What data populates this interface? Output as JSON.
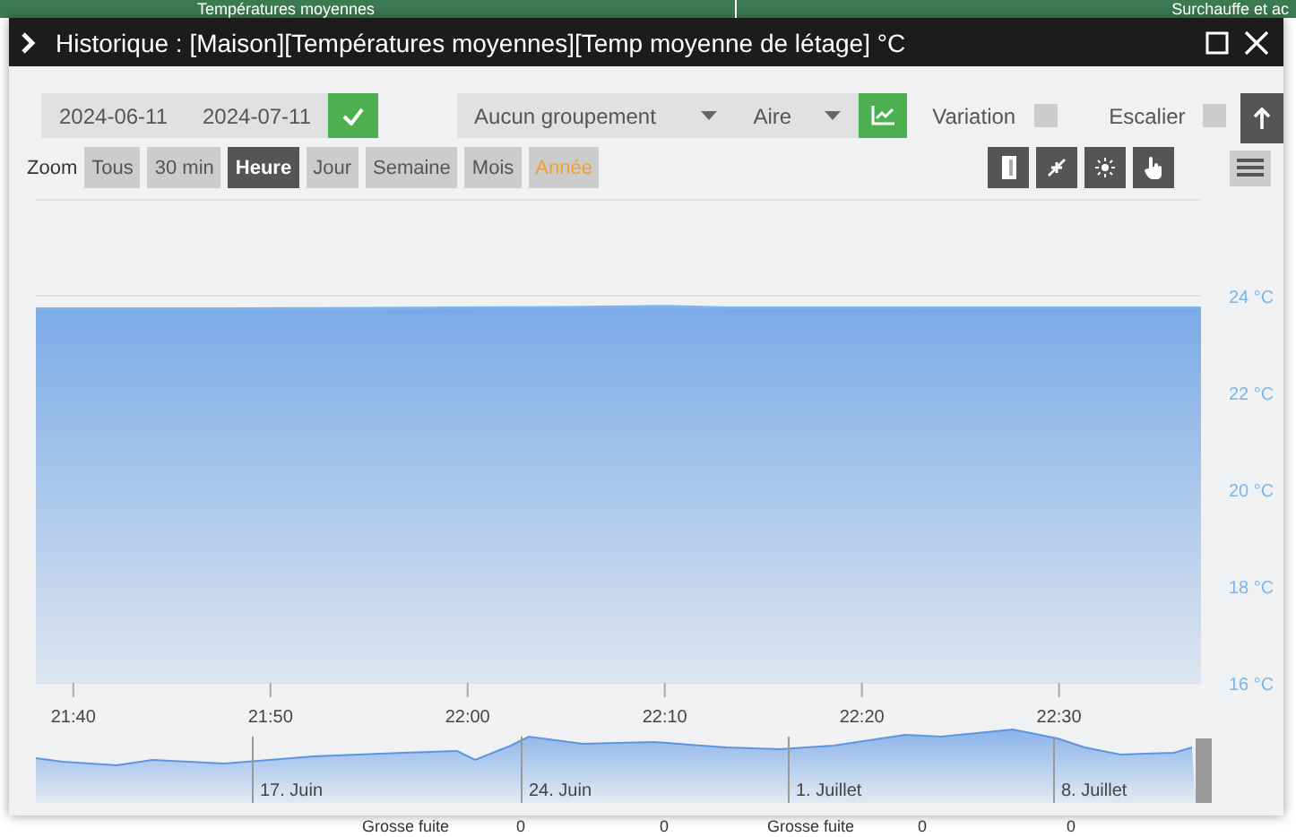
{
  "background": {
    "top_bar": [
      "Températures moyennes",
      "Surchauffe et ac"
    ],
    "bottom_row": [
      "Grosse fuite",
      "0",
      "0",
      "Grosse fuite",
      "0",
      "0"
    ]
  },
  "window": {
    "title": "Historique : [Maison][Températures moyennes][Temp moyenne de létage] °C"
  },
  "toolbar": {
    "start_date": "2024-06-11",
    "end_date": "2024-07-11",
    "grouping": "Aucun groupement",
    "chart_type": "Aire",
    "options": [
      {
        "label": "Variation",
        "checked": false
      },
      {
        "label": "Escalier",
        "checked": false
      }
    ]
  },
  "zoom": {
    "label": "Zoom",
    "buttons": [
      {
        "label": "Tous",
        "selected": false,
        "hovered": false
      },
      {
        "label": "30 min",
        "selected": false,
        "hovered": false
      },
      {
        "label": "Heure",
        "selected": true,
        "hovered": false
      },
      {
        "label": "Jour",
        "selected": false,
        "hovered": false
      },
      {
        "label": "Semaine",
        "selected": false,
        "hovered": false
      },
      {
        "label": "Mois",
        "selected": false,
        "hovered": false
      },
      {
        "label": "Année",
        "selected": false,
        "hovered": true
      }
    ]
  },
  "chart": {
    "chart_data": {
      "type": "area",
      "x": [
        1298.1,
        1305,
        1315,
        1325,
        1330,
        1333.2,
        1357.2
      ],
      "series": [
        {
          "color": "#7cb5ec",
          "values": [
            23.73,
            23.73,
            23.74,
            23.76,
            23.78,
            23.75,
            23.75
          ]
        }
      ],
      "ylim": [
        16,
        26
      ],
      "xlim": [
        1298.1,
        1357.2
      ],
      "yticks": [
        {
          "value": 16,
          "label": "16 °C"
        },
        {
          "value": 18,
          "label": "18 °C"
        },
        {
          "value": 20,
          "label": "20 °C"
        },
        {
          "value": 22,
          "label": "22 °C"
        },
        {
          "value": 24,
          "label": "24 °C"
        }
      ],
      "xticks": [
        {
          "value": 1300,
          "label": "21:40"
        },
        {
          "value": 1310,
          "label": "21:50"
        },
        {
          "value": 1320,
          "label": "22:00"
        },
        {
          "value": 1330,
          "label": "22:10"
        },
        {
          "value": 1340,
          "label": "22:20"
        },
        {
          "value": 1350,
          "label": "22:30"
        }
      ]
    },
    "navigator_labels": [
      "17. Juin",
      "24. Juin",
      "1. Juillet",
      "8. Juillet"
    ]
  }
}
